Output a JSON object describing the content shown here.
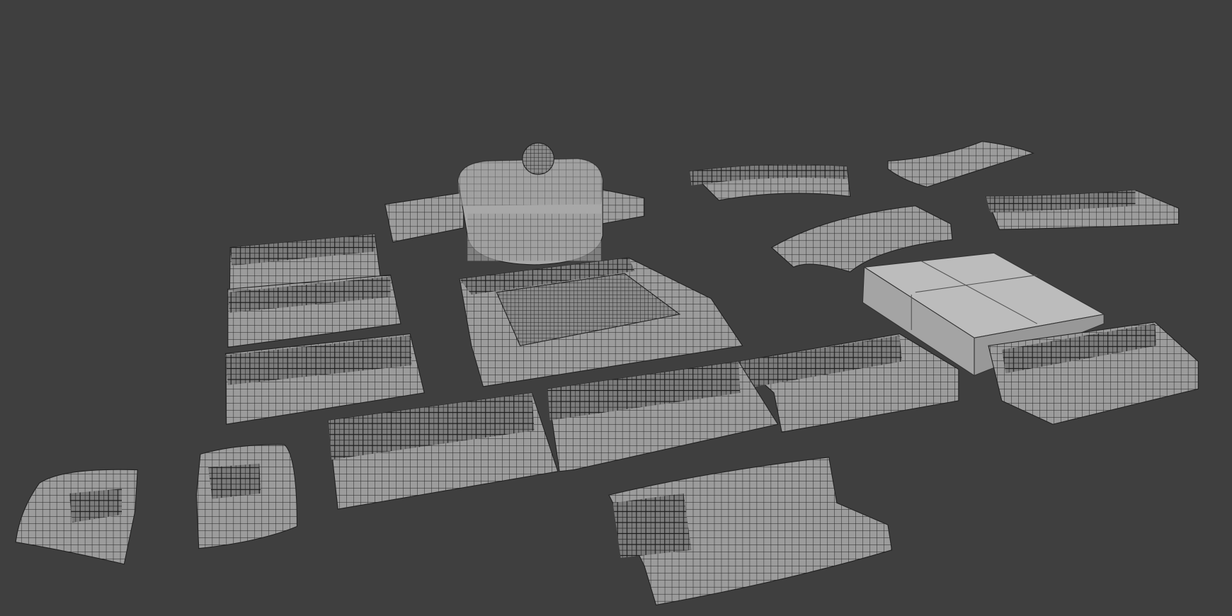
{
  "scene": {
    "background_color": "#3f3f3f",
    "mesh_color": "#9c9c9c",
    "wire_color": "#262626",
    "solid_block_color": "#b4b4b4",
    "objects": [
      "bunker-dome",
      "trench-straight-left-a",
      "trench-straight-left-b",
      "trench-straight-left-c",
      "trench-square-pit",
      "trench-curved-a",
      "trench-curved-b",
      "trench-curved-c",
      "trench-curved-d",
      "concrete-block",
      "trench-end-right",
      "trench-bottom-a",
      "trench-bottom-b",
      "trench-bottom-c",
      "trench-corner-a",
      "trench-corner-b",
      "trench-junction"
    ]
  }
}
